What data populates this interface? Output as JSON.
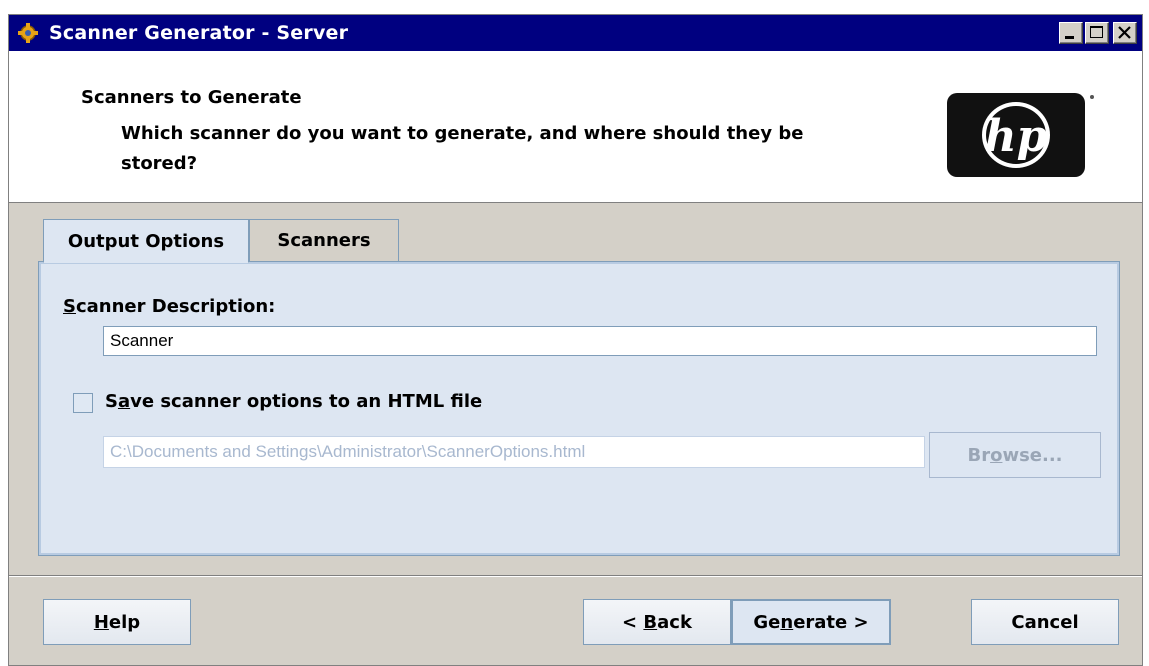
{
  "window": {
    "title": "Scanner Generator - Server",
    "title_bar_color": "#000080",
    "icon": "scanner-generator-app-icon"
  },
  "header": {
    "title": "Scanners to Generate",
    "subtitle": "Which scanner do you want to generate, and where should they be stored?",
    "logo": "hp-logo",
    "logo_text": "hp"
  },
  "tabs": [
    {
      "label": "Output Options",
      "active": true
    },
    {
      "label": "Scanners",
      "active": false
    }
  ],
  "output_options": {
    "description_label": {
      "pre": "",
      "mnemonic": "S",
      "post": "canner Description:"
    },
    "description_value": "Scanner",
    "save_checkbox": {
      "checked": false,
      "label_pre": "S",
      "label_mnemonic": "a",
      "label_post": "ve scanner options to an HTML file"
    },
    "html_path": "C:\\Documents and Settings\\Administrator\\ScannerOptions.html",
    "browse": {
      "pre": "Br",
      "mnemonic": "o",
      "post": "wse...",
      "enabled": false
    }
  },
  "footer": {
    "help": {
      "pre": "",
      "mnemonic": "H",
      "post": "elp"
    },
    "back": {
      "pre": "< ",
      "mnemonic": "B",
      "post": "ack"
    },
    "generate": {
      "pre": "Ge",
      "mnemonic": "n",
      "post": "erate >"
    },
    "cancel": {
      "label": "Cancel"
    }
  },
  "colors": {
    "panel_bg": "#dde6f2",
    "border": "#7f9db9",
    "window_bg": "#d4d0c8"
  }
}
